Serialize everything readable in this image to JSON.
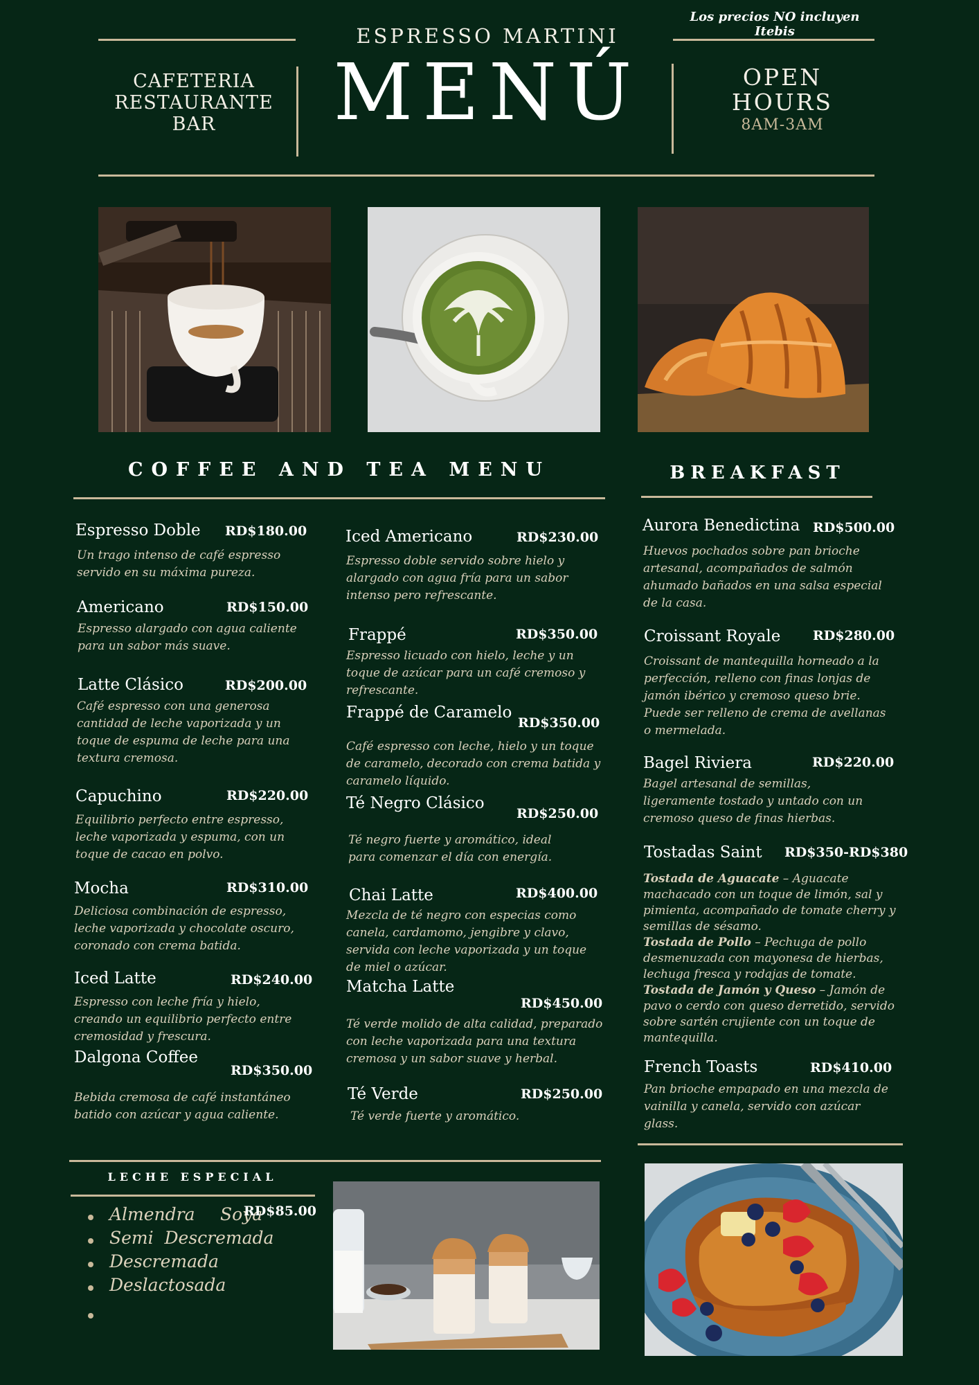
{
  "header": {
    "tax_note": "Los precios NO incluyen Itebis",
    "business_name": "ESPRESSO MARTINI",
    "main_title": "MENÚ",
    "left_line1": "CAFETERIA",
    "left_line2": "RESTAURANTE",
    "left_line3": "BAR",
    "right_line1": "OPEN",
    "right_line2": "HOURS",
    "hours": "8AM-3AM"
  },
  "coffee": {
    "title": "COFFEE AND TEA MENU",
    "left": [
      {
        "name": "Espresso Doble",
        "price": "RD$180.00",
        "desc": "Un trago intenso de café espresso servido en su máxima pureza."
      },
      {
        "name": "Americano",
        "price": "RD$150.00",
        "desc": "Espresso alargado con agua caliente para un sabor más suave."
      },
      {
        "name": "Latte Clásico",
        "price": "RD$200.00",
        "desc": "Café espresso con una generosa cantidad de leche vaporizada y un toque de espuma de leche para una textura cremosa."
      },
      {
        "name": "Capuchino",
        "price": "RD$220.00",
        "desc": "Equilibrio perfecto entre espresso, leche vaporizada y espuma, con un toque de cacao en polvo."
      },
      {
        "name": "Mocha",
        "price": "RD$310.00",
        "desc": "Deliciosa combinación de espresso, leche vaporizada y chocolate oscuro, coronado con crema batida."
      },
      {
        "name": "Iced Latte",
        "price": "RD$240.00",
        "desc": "Espresso con leche fría y hielo, creando un equilibrio perfecto entre cremosidad y frescura."
      },
      {
        "name": "Dalgona Coffee",
        "price": "RD$350.00",
        "desc": "Bebida cremosa de café instantáneo batido con azúcar y agua caliente."
      }
    ],
    "right": [
      {
        "name": "Iced Americano",
        "price": "RD$230.00",
        "desc": "Espresso doble servido sobre hielo y alargado con agua fría para un sabor intenso pero refrescante."
      },
      {
        "name": "Frappé",
        "price": "RD$350.00",
        "desc": "Espresso licuado con hielo, leche y un toque de azúcar para un café cremoso y refrescante."
      },
      {
        "name": "Frappé de Caramelo",
        "price": "RD$350.00",
        "desc": "Café espresso con leche, hielo y un toque de caramelo, decorado con crema batida y caramelo líquido."
      },
      {
        "name": "Té Negro Clásico",
        "price": "RD$250.00",
        "desc": "Té negro fuerte y aromático, ideal para comenzar el día con energía."
      },
      {
        "name": "Chai Latte",
        "price": "RD$400.00",
        "desc": "Mezcla de té negro con especias como canela, cardamomo, jengibre y clavo, servida con leche vaporizada y un toque de miel o azúcar."
      },
      {
        "name": "Matcha Latte",
        "price": "RD$450.00",
        "desc": "Té verde molido de alta calidad, preparado con leche vaporizada para una textura cremosa y un sabor suave y herbal."
      },
      {
        "name": "Té Verde",
        "price": "RD$250.00",
        "desc": "Té verde fuerte y aromático."
      }
    ]
  },
  "breakfast": {
    "title": "BREAKFAST",
    "items": [
      {
        "name": "Aurora Benedictina",
        "price": "RD$500.00",
        "desc": "Huevos pochados sobre pan brioche artesanal, acompañados de salmón ahumado bañados en una salsa especial de la casa."
      },
      {
        "name": "Croissant Royale",
        "price": "RD$280.00",
        "desc": "Croissant de mantequilla horneado a la perfección, relleno con finas lonjas de jamón ibérico y cremoso queso brie. Puede ser relleno de crema de avellanas o mermelada."
      },
      {
        "name": "Bagel Riviera",
        "price": "RD$220.00",
        "desc": "Bagel artesanal de semillas, ligeramente tostado y untado con un cremoso queso de finas hierbas."
      },
      {
        "name": "Tostadas Saint",
        "price": "RD$350-RD$380"
      },
      {
        "name": "French Toasts",
        "price": "RD$410.00",
        "desc": "Pan brioche empapado en una mezcla de vainilla y canela, servido con azúcar glass."
      }
    ],
    "tostadas": [
      {
        "label": "Tostada de Aguacate",
        "text": " – Aguacate machacado con un toque de limón, sal y pimienta, acompañado de tomate cherry y semillas de sésamo."
      },
      {
        "label": "Tostada de Pollo",
        "text": " – Pechuga de pollo desmenuzada con mayonesa de hierbas, lechuga fresca y rodajas de tomate."
      },
      {
        "label": "Tostada de Jamón y Queso",
        "text": " – Jamón de pavo o cerdo con queso derretido, servido sobre sartén crujiente con un toque de mantequilla."
      }
    ]
  },
  "leche": {
    "title": "LECHE ESPECIAL",
    "price": "RD$85.00",
    "options": [
      "Almendra",
      "Soya",
      "Semi  Descremada",
      "Descremada",
      "Deslactosada"
    ]
  },
  "images": [
    {
      "name": "espresso-photo-image"
    },
    {
      "name": "matcha-latte-photo-image"
    },
    {
      "name": "croissant-photo-image"
    },
    {
      "name": "dalgona-coffee-photo-image"
    },
    {
      "name": "french-toast-photo-image"
    }
  ]
}
